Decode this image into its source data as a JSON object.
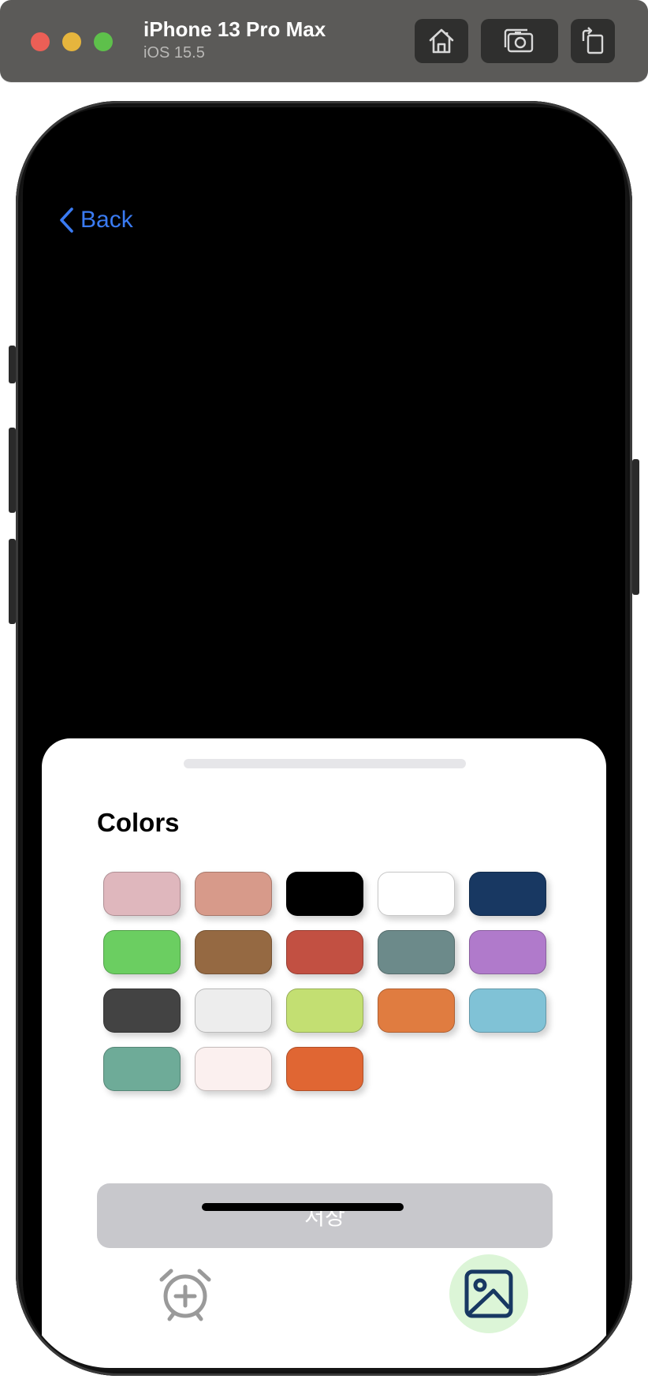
{
  "window": {
    "device_name": "iPhone 13 Pro Max",
    "os_version": "iOS 15.5",
    "toolbar_icons": [
      "home-icon",
      "screenshot-icon",
      "rotate-icon"
    ]
  },
  "nav": {
    "back_label": "Back"
  },
  "sheet": {
    "title": "Colors",
    "swatches": [
      "#dfb7bd",
      "#d79a8a",
      "#000000",
      "#ffffff",
      "#183862",
      "#6bce61",
      "#956942",
      "#c25042",
      "#6c8a8a",
      "#b07acb",
      "#434343",
      "#ededed",
      "#c3df72",
      "#e07c40",
      "#80c2d6",
      "#6eab98",
      "#fbf0ef",
      "#e06633"
    ],
    "save_label": "저장"
  },
  "tabbar": {
    "items": [
      {
        "icon": "alarm-add-icon"
      },
      {
        "icon": "photo-icon",
        "selected": true
      }
    ]
  },
  "colors": {
    "accent": "#3a7bf2",
    "selected_tab_bg": "#dcf5d7",
    "selected_tab_icon": "#183862",
    "disabled_button": "#c8c8cc"
  }
}
